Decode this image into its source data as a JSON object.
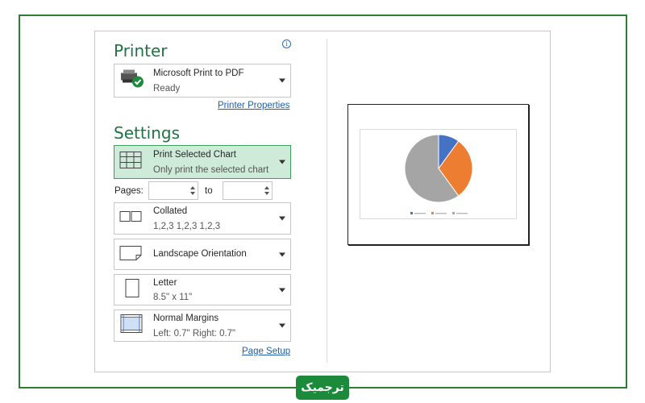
{
  "printer": {
    "title": "Printer",
    "device_name": "Microsoft Print to PDF",
    "device_status": "Ready",
    "properties_link": "Printer Properties"
  },
  "settings": {
    "title": "Settings",
    "print_what": {
      "main": "Print Selected Chart",
      "sub": "Only print the selected chart"
    },
    "pages_label": "Pages:",
    "to_label": "to",
    "pages_from": "",
    "pages_to": "",
    "collation": {
      "main": "Collated",
      "sub": "1,2,3    1,2,3    1,2,3"
    },
    "orientation": {
      "main": "Landscape Orientation"
    },
    "paper": {
      "main": "Letter",
      "sub": "8.5\" x 11\""
    },
    "margins": {
      "main": "Normal Margins",
      "sub": "Left:  0.7\"    Right:  0.7\""
    },
    "page_setup_link": "Page Setup"
  },
  "badge": {
    "text": "ترجمیک"
  },
  "chart_data": {
    "type": "pie",
    "title": "",
    "values": [
      10,
      30,
      60
    ],
    "colors": [
      "#4472c4",
      "#ed7d31",
      "#a5a5a5"
    ],
    "legend": "bottom"
  }
}
